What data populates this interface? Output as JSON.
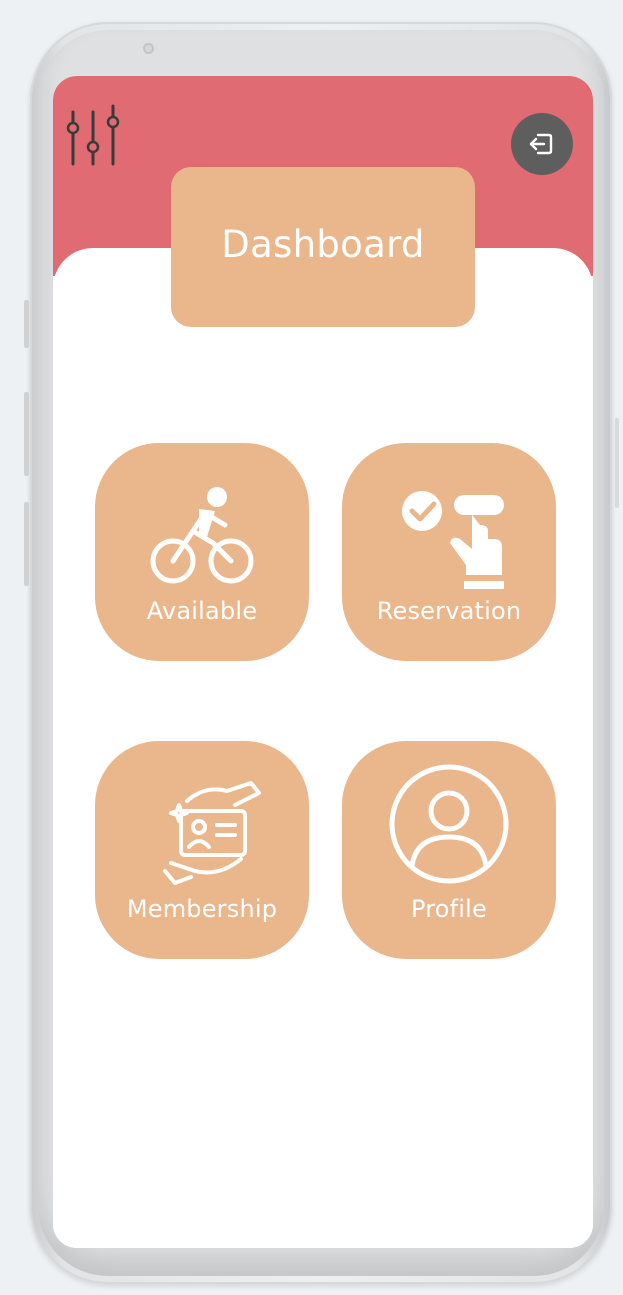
{
  "header": {
    "title": "Dashboard",
    "settings_icon": "sliders-icon",
    "logout_icon": "logout-icon"
  },
  "colors": {
    "header": "#e06b73",
    "card": "#e9b78b",
    "logout_button": "#5e5e5e",
    "text_on_card": "#ffffff"
  },
  "menu": [
    {
      "label": "Available",
      "icon": "bicycle-icon"
    },
    {
      "label": "Reservation",
      "icon": "tap-check-icon"
    },
    {
      "label": "Membership",
      "icon": "membership-card-icon"
    },
    {
      "label": "Profile",
      "icon": "user-circle-icon"
    }
  ]
}
